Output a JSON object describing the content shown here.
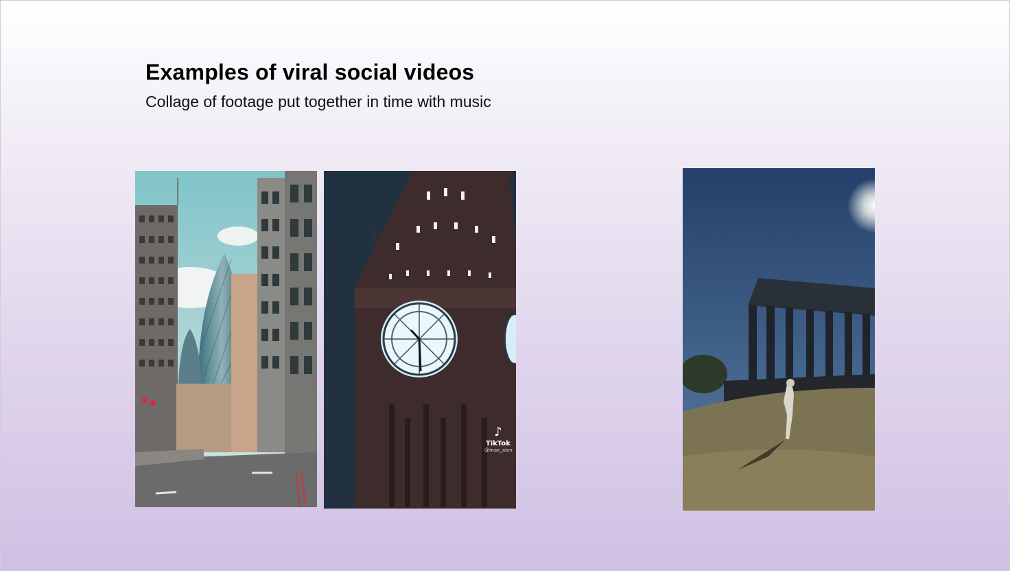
{
  "slide": {
    "title": "Examples of viral social videos",
    "subtitle": "Collage of footage put together in time with music"
  },
  "videos": [
    {
      "scene": "city-street-gherkin"
    },
    {
      "scene": "big-ben-clock-tower",
      "watermark": {
        "icon": "tiktok-note-icon",
        "brand": "TikTok",
        "handle": "@max_aion"
      }
    },
    {
      "scene": "hilltop-monument-walker"
    }
  ],
  "colors": {
    "gradient_top": "#ffffff",
    "gradient_bottom": "#cfc0e3"
  }
}
